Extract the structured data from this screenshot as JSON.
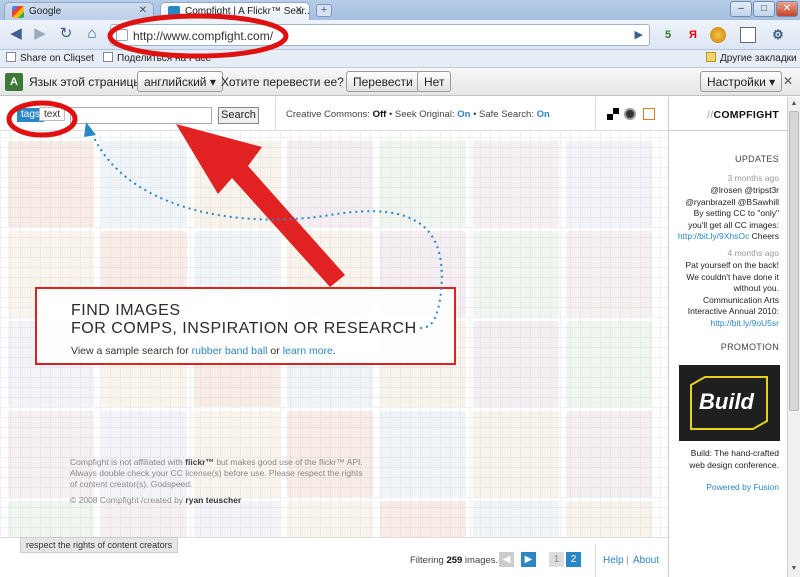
{
  "browser": {
    "tabs": [
      {
        "label": "Google"
      },
      {
        "label": "Compfight | A Flickr™ Sear..."
      }
    ],
    "new_tab_label": "+",
    "window_buttons": {
      "minimize": "–",
      "maximize": "□",
      "close": "✕"
    },
    "url": "http://www.compfight.com/",
    "bookmarks": [
      "Share on Cliqset",
      "Поделиться на Face"
    ],
    "other_bookmarks": "Другие закладки",
    "ext_icons": [
      "5",
      "Я",
      "",
      ""
    ]
  },
  "translate_bar": {
    "lang_label": "Язык этой страницы",
    "lang_value": "английский ▾",
    "question": "Хотите перевести ее?",
    "translate": "Перевести",
    "no": "Нет",
    "settings": "Настройки ▾"
  },
  "search": {
    "mode_tags": "tags",
    "mode_text": "text",
    "input_value": "",
    "button": "Search"
  },
  "filters": {
    "cc_label": "Creative Commons:",
    "cc_value": "Off",
    "seek_label": "Seek Original:",
    "seek_value": "On",
    "safe_label": "Safe Search:",
    "safe_value": "On",
    "sep": "•"
  },
  "info": {
    "line1": "FIND IMAGES",
    "line2": "FOR COMPS, INSPIRATION OR RESEARCH",
    "lead": "View a sample search for ",
    "link1": "rubber band ball",
    "mid": " or ",
    "link2": "learn more",
    "tail": "."
  },
  "disclaimer": {
    "p1": "Compfight is not affiliated with ",
    "flickr": "flickr™",
    "p2": " but makes good use of the flickr™ API. Always double check your CC license(s) before use. Please respect the rights of content creator(s). Godspeed.",
    "copy": "© 2008 Compfight /created by ",
    "author": "ryan teuscher"
  },
  "footer": {
    "respect": "respect the rights of content creators",
    "filtering_pre": "Filtering ",
    "filtering_count": "259",
    "filtering_post": " images.",
    "pages": [
      "1",
      "2"
    ],
    "help": "Help",
    "sep": "|",
    "about": "About"
  },
  "sidebar": {
    "brand_prefix": "//",
    "brand": "COMPFIGHT",
    "updates": "UPDATES",
    "u1_time": "3 months ago",
    "u1_text": "@lrosen @tripst3r @ryanbrazell @BSawhill By setting CC to \"only\" you'll get all CC images:",
    "u1_link": "http://bit.ly/9XhsOc",
    "u1_tail": " Cheers",
    "u2_time": "4 months ago",
    "u2_text": "Pat yourself on the back! We couldn't have done it without you. Communication Arts Interactive Annual 2010:",
    "u2_link": "http://bit.ly/9oU5sr",
    "promotion": "PROMOTION",
    "ad_text": "Build",
    "ad_caption": "Build: The hand-crafted web design conference.",
    "powered": "Powered by Fusion"
  },
  "colors": {
    "accent": "#2b86c5",
    "annotation": "#e01010"
  }
}
